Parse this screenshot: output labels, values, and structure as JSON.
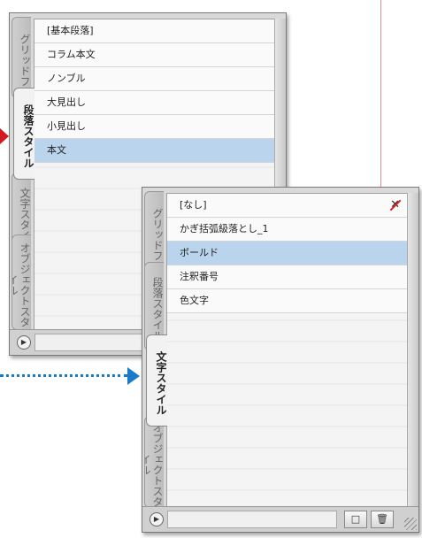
{
  "colors": {
    "accent_red": "#d3191f",
    "accent_blue": "#1a7cc8",
    "selection": "#bad4ee"
  },
  "paragraph_panel": {
    "tabs": [
      {
        "label": "グリッドフ",
        "active": false
      },
      {
        "label": "段落スタイル",
        "active": true
      },
      {
        "label": "文字スタイル",
        "active": false
      },
      {
        "label": "オブジェクトスタイル",
        "active": false
      }
    ],
    "styles": [
      {
        "label": "[基本段落]",
        "selected": false
      },
      {
        "label": "コラム本文",
        "selected": false
      },
      {
        "label": "ノンブル",
        "selected": false
      },
      {
        "label": "大見出し",
        "selected": false
      },
      {
        "label": "小見出し",
        "selected": false
      },
      {
        "label": "本文",
        "selected": true
      }
    ],
    "menu_icon": "panel-menu-icon"
  },
  "character_panel": {
    "tabs": [
      {
        "label": "グリッドフ",
        "active": false
      },
      {
        "label": "段落スタイル",
        "active": false
      },
      {
        "label": "文字スタイル",
        "active": true
      },
      {
        "label": "オブジェクトスタイル",
        "active": false
      }
    ],
    "styles": [
      {
        "label": "[なし]",
        "selected": false,
        "has_none_icon": true
      },
      {
        "label": "かぎ括弧級落とし_1",
        "selected": false
      },
      {
        "label": "ボールド",
        "selected": true
      },
      {
        "label": "注釈番号",
        "selected": false
      },
      {
        "label": "色文字",
        "selected": false
      }
    ],
    "footer_buttons": {
      "new_style_icon": "new-style-icon",
      "delete_icon": "trash-icon",
      "new_label": "□",
      "delete_label": "🗑"
    }
  }
}
